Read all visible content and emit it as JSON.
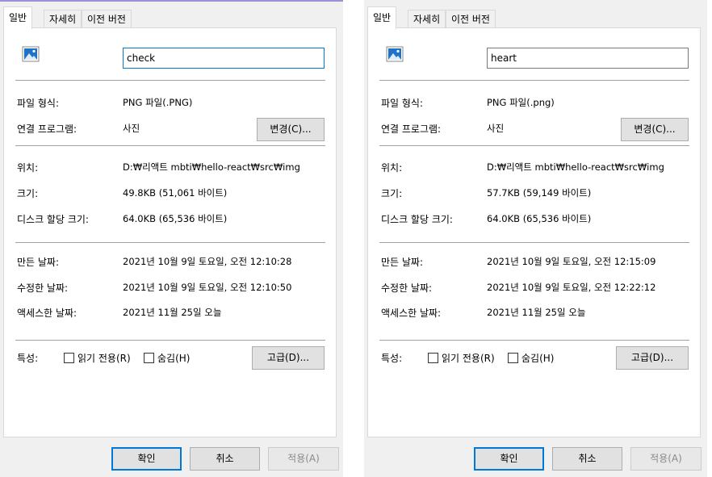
{
  "tabs": [
    "일반",
    "자세히",
    "이전 버전"
  ],
  "labels": {
    "file_type": "파일 형식:",
    "opens_with": "연결 프로그램:",
    "location": "위치:",
    "size": "크기:",
    "size_on_disk": "디스크 할당 크기:",
    "created": "만든 날짜:",
    "modified": "수정한 날짜:",
    "accessed": "액세스한 날짜:",
    "attributes": "특성:",
    "readonly": "읽기 전용(R)",
    "hidden": "숨김(H)"
  },
  "buttons": {
    "change": "변경(C)...",
    "advanced": "고급(D)...",
    "ok": "확인",
    "cancel": "취소",
    "apply": "적용(A)"
  },
  "dialogs": [
    {
      "file_name": "check",
      "file_type": "PNG 파일(.PNG)",
      "opens_with": "사진",
      "location": "D:₩리액트 mbti₩hello-react₩src₩img",
      "size": "49.8KB (51,061 바이트)",
      "size_on_disk": "64.0KB (65,536 바이트)",
      "created": "2021년 10월 9일 토요일, 오전 12:10:28",
      "modified": "2021년 10월 9일 토요일, 오전 12:10:50",
      "accessed": "2021년 11월 25일 오늘"
    },
    {
      "file_name": "heart",
      "file_type": "PNG 파일(.png)",
      "opens_with": "사진",
      "location": "D:₩리액트 mbti₩hello-react₩src₩img",
      "size": "57.7KB (59,149 바이트)",
      "size_on_disk": "64.0KB (65,536 바이트)",
      "created": "2021년 10월 9일 토요일, 오전 12:15:09",
      "modified": "2021년 10월 9일 토요일, 오전 12:22:12",
      "accessed": "2021년 11월 25일 오늘"
    }
  ],
  "icons": {
    "file": "image-file-icon"
  },
  "colors": {
    "accent": "#0078d7",
    "separator": "#a0a0a0"
  }
}
